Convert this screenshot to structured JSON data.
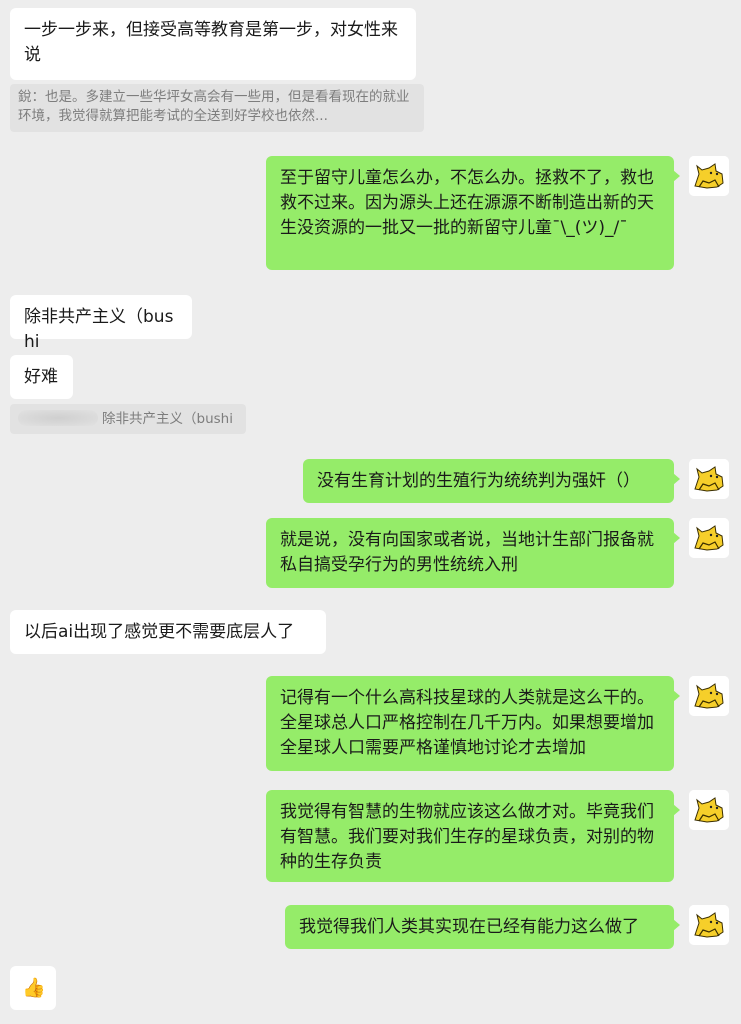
{
  "messages": [
    {
      "text": "一步一步来，但接受高等教育是第一步，对女性来说"
    },
    {
      "quote": "銳：也是。多建立一些华坪女高会有一些用，但是看看现在的就业环境，我觉得就算把能考试的全送到好学校也依然..."
    },
    {
      "text": "至于留守儿童怎么办，不怎么办。拯救不了，救也救不过来。因为源头上还在源源不断制造出新的天生没资源的一批又一批的新留守儿童¯\\_(ツ)_/¯"
    },
    {
      "text": "除非共产主义（bushi"
    },
    {
      "text": "好难"
    },
    {
      "quote": "除非共产主义（bushi"
    },
    {
      "text": "没有生育计划的生殖行为统统判为强奸（）"
    },
    {
      "text": "就是说，没有向国家或者说，当地计生部门报备就私自搞受孕行为的男性统统入刑"
    },
    {
      "text": "以后ai出现了感觉更不需要底层人了"
    },
    {
      "text": "记得有一个什么高科技星球的人类就是这么干的。全星球总人口严格控制在几千万内。如果想要增加全星球人口需要严格谨慎地讨论才去增加"
    },
    {
      "text": "我觉得有智慧的生物就应该这么做才对。毕竟我们有智慧。我们要对我们生存的星球负责，对别的物种的生存负责"
    },
    {
      "text": "我觉得我们人类其实现在已经有能力这么做了"
    },
    {
      "emoji": "👍"
    }
  ],
  "avatar_icon": "cat-avatar-icon",
  "colors": {
    "background": "#ededed",
    "incoming_bubble": "#ffffff",
    "outgoing_bubble": "#95ec69",
    "quote_bg": "#e2e2e2",
    "quote_text": "#7d7d7d"
  }
}
